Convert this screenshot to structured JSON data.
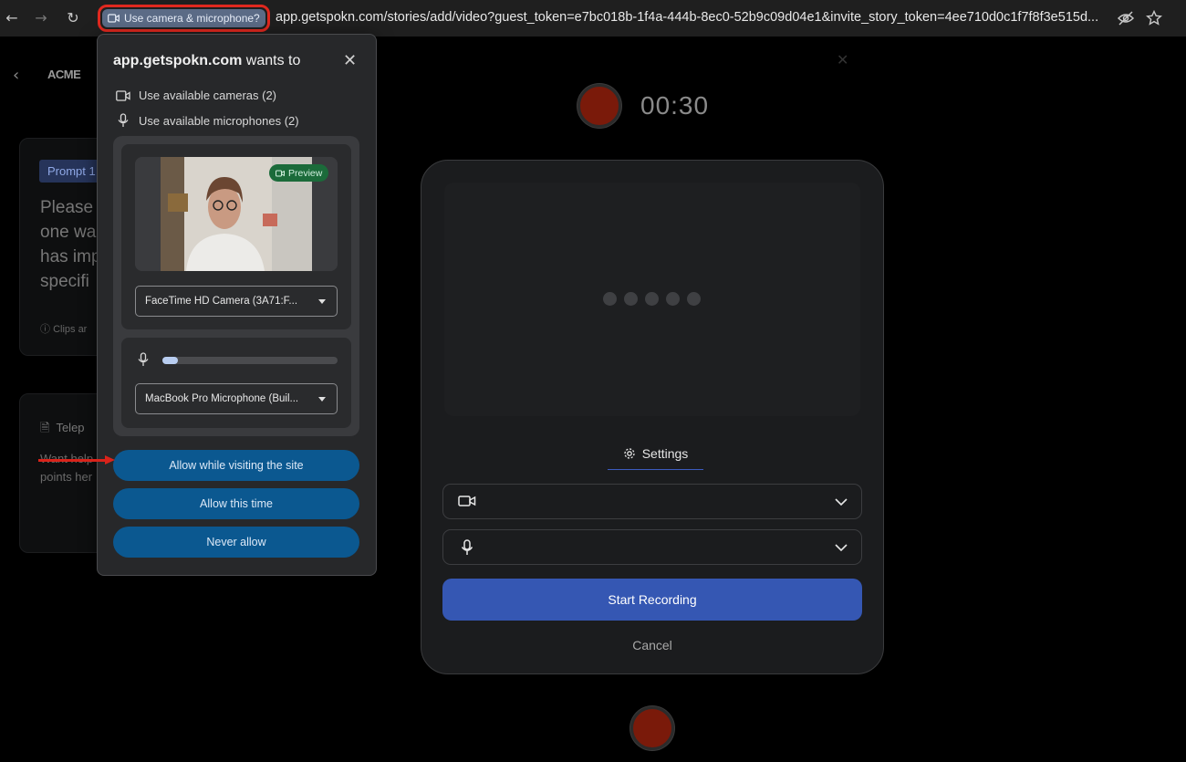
{
  "browser": {
    "permission_chip": "Use camera & microphone?",
    "url": "app.getspokn.com/stories/add/video?guest_token=e7bc018b-1f4a-444b-8ec0-52b9c09d04e1&invite_story_token=4ee710d0c1f7f8f3e515d..."
  },
  "background": {
    "logo": "ACME",
    "prompt_tag": "Prompt 1",
    "prompt_text_lines": [
      "Please",
      "one wa",
      "has imp",
      "specifi"
    ],
    "clips_note": "Clips ar",
    "teleprompter": "Telep",
    "want_help_lines": [
      "Want help",
      "points her"
    ],
    "timer": "00:30",
    "settings_tab": "Settings",
    "start_recording": "Start Recording",
    "cancel": "Cancel"
  },
  "popup": {
    "site": "app.getspokn.com",
    "title_suffix": " wants to",
    "camera_perm": "Use available cameras (2)",
    "mic_perm": "Use available microphones (2)",
    "preview_badge": "Preview",
    "camera_select": "FaceTime HD Camera (3A71:F...",
    "mic_select": "MacBook Pro Microphone (Buil...",
    "mic_level_fraction": 0.09,
    "allow_site": "Allow while visiting the site",
    "allow_once": "Allow this time",
    "never_allow": "Never allow"
  },
  "colors": {
    "accent_blue": "#3557b3",
    "popup_button": "#0b5890",
    "record_red": "#7a1a0a",
    "highlight_red": "#e0281f"
  }
}
